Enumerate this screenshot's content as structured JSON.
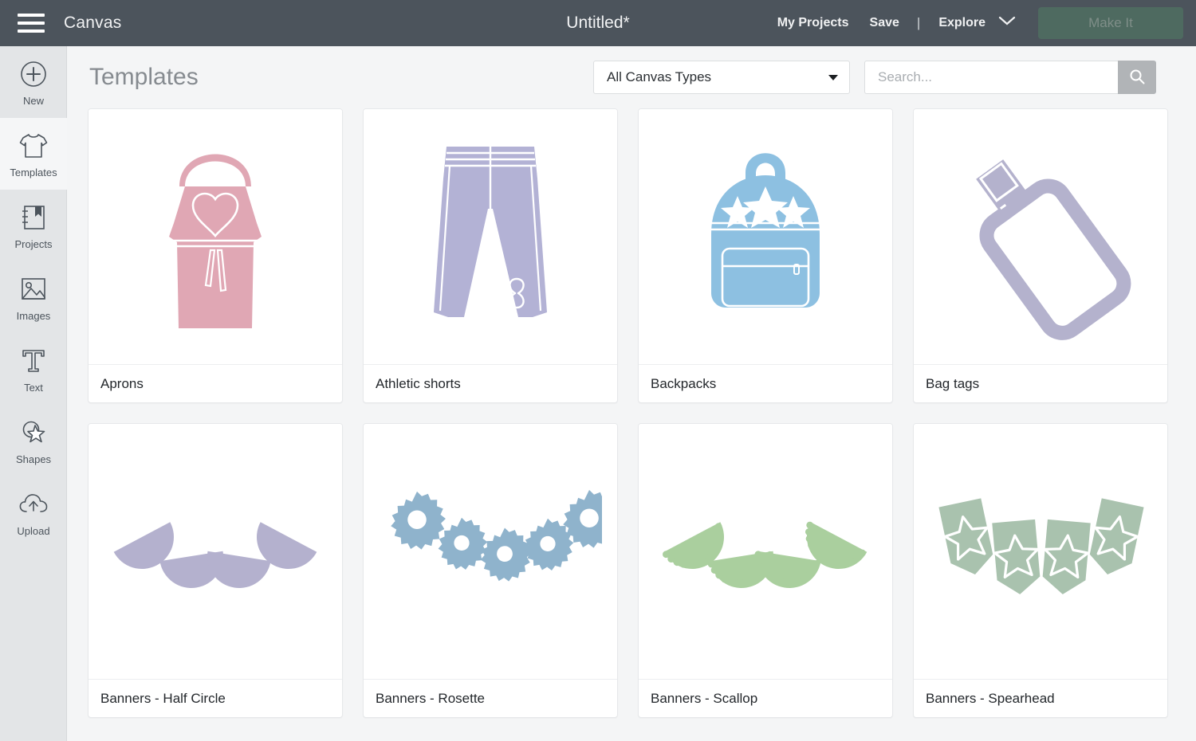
{
  "topbar": {
    "menu_icon": "hamburger-icon",
    "app_name": "Canvas",
    "doc_title": "Untitled*",
    "my_projects": "My Projects",
    "save": "Save",
    "separator": "|",
    "explore": "Explore",
    "explore_caret_icon": "chevron-down-icon",
    "make_it": "Make It",
    "bg_color": "#4c545c",
    "make_it_color": "#4e6a60",
    "make_it_text_color": "#7f8e88"
  },
  "sidebar": {
    "bg_color": "#e3e5e7",
    "selected": "Templates",
    "items": [
      {
        "label": "New",
        "icon": "plus-circle-icon",
        "selected": false
      },
      {
        "label": "Templates",
        "icon": "tshirt-icon",
        "selected": true
      },
      {
        "label": "Projects",
        "icon": "notebook-bookmark-icon",
        "selected": false
      },
      {
        "label": "Images",
        "icon": "image-icon",
        "selected": false
      },
      {
        "label": "Text",
        "icon": "text-t-icon",
        "selected": false
      },
      {
        "label": "Shapes",
        "icon": "shapes-star-circle-icon",
        "selected": false
      },
      {
        "label": "Upload",
        "icon": "cloud-upload-icon",
        "selected": false
      }
    ]
  },
  "main": {
    "page_title": "Templates",
    "canvas_type_filter": {
      "value": "All Canvas Types",
      "caret_icon": "caret-down-icon"
    },
    "search": {
      "placeholder": "Search...",
      "value": "",
      "button_icon": "search-icon",
      "button_color": "#b1b4b7"
    },
    "cards": [
      {
        "label": "Aprons",
        "art": "apron",
        "color": "#e0a7b4"
      },
      {
        "label": "Athletic shorts",
        "art": "shorts",
        "color": "#b3b2d5"
      },
      {
        "label": "Backpacks",
        "art": "backpack",
        "color": "#8dc0e1"
      },
      {
        "label": "Bag tags",
        "art": "bagtag",
        "color": "#b4b2cd"
      },
      {
        "label": "Banners - Half Circle",
        "art": "halfcircle",
        "color": "#b4b1ce"
      },
      {
        "label": "Banners - Rosette",
        "art": "rosette",
        "color": "#8fb3cc"
      },
      {
        "label": "Banners - Scallop",
        "art": "scallop",
        "color": "#aacf9e"
      },
      {
        "label": "Banners - Spearhead",
        "art": "spearhead",
        "color": "#a9c2ae"
      }
    ]
  }
}
